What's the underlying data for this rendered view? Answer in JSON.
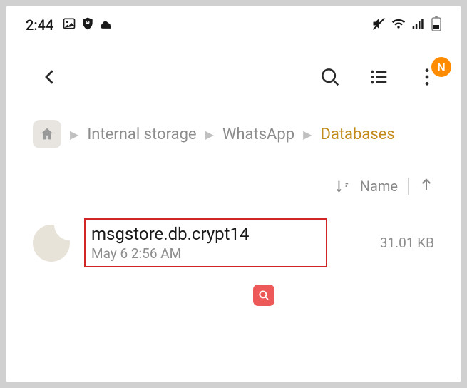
{
  "status": {
    "time": "2:44"
  },
  "breadcrumb": {
    "items": [
      "Internal storage",
      "WhatsApp",
      "Databases"
    ]
  },
  "sort": {
    "label": "Name"
  },
  "file": {
    "name": "msgstore.db.crypt14",
    "date": "May 6 2:56 AM",
    "size": "31.01 KB"
  },
  "avatar": {
    "initial": "N"
  }
}
